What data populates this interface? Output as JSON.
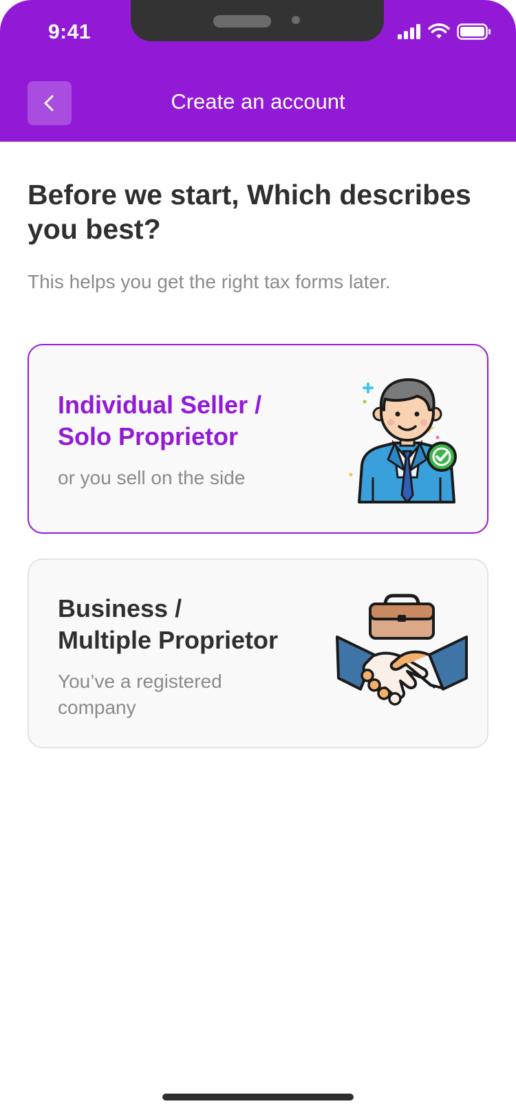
{
  "status_bar": {
    "time": "9:41"
  },
  "nav": {
    "title": "Create an account",
    "back_icon": "chevron-left-icon"
  },
  "intro": {
    "heading": "Before we start, Which describes you best?",
    "subheading": "This helps you get the right tax forms later."
  },
  "options": [
    {
      "title_line1": "Individual Seller /",
      "title_line2": "Solo Proprietor",
      "description": "or you sell on the side",
      "icon": "businessman-icon",
      "selected": true
    },
    {
      "title_line1": "Business /",
      "title_line2": "Multiple Proprietor",
      "description": "You’ve a registered company",
      "icon": "handshake-briefcase-icon",
      "selected": false
    }
  ],
  "colors": {
    "brand": "#921ad6",
    "text": "#2f2f2f",
    "muted": "#8a8a8a"
  }
}
